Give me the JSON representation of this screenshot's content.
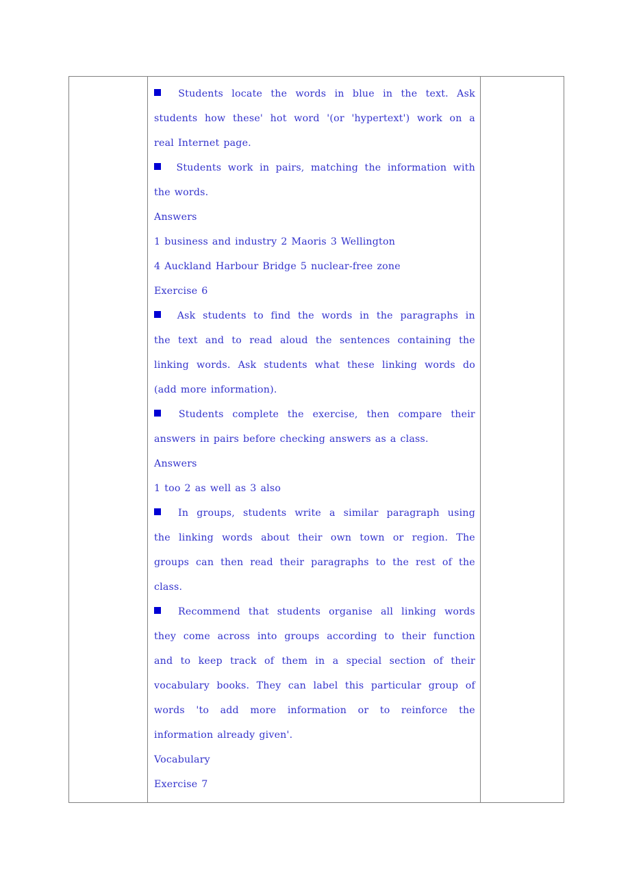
{
  "document": {
    "text_color": "#3333cc",
    "bullet_color": "#0000d4",
    "border_color": "#808080",
    "columns": {
      "left_label": "",
      "right_label": ""
    },
    "bullet_icon": "filled-square-bullet",
    "lines": [
      {
        "id": "l1",
        "bullet": true,
        "justify": true,
        "words": [
          "Students",
          "locate",
          "the",
          "words",
          "in",
          "blue",
          "in",
          "the",
          "text.",
          "Ask"
        ]
      },
      {
        "id": "l2",
        "bullet": false,
        "justify": true,
        "words": [
          "students",
          "how",
          "these'",
          "hot",
          "word",
          "'(or",
          "'hypertext')",
          "work",
          "on",
          "a"
        ]
      },
      {
        "id": "l3",
        "bullet": false,
        "justify": false,
        "words": [
          "real",
          "Internet",
          "page."
        ]
      },
      {
        "id": "l4",
        "bullet": true,
        "justify": true,
        "words": [
          "Students",
          "work",
          "in",
          "pairs,",
          "matching",
          "the",
          "information",
          "with"
        ]
      },
      {
        "id": "l5",
        "bullet": false,
        "justify": false,
        "words": [
          "the",
          "words."
        ]
      },
      {
        "id": "l6",
        "bullet": false,
        "justify": false,
        "words": [
          "Answers"
        ]
      },
      {
        "id": "l7",
        "bullet": false,
        "justify": false,
        "words": [
          "1",
          "business",
          "and",
          "industry",
          "2",
          "Maoris",
          "3",
          "Wellington"
        ]
      },
      {
        "id": "l8",
        "bullet": false,
        "justify": false,
        "words": [
          "4",
          "Auckland",
          "Harbour",
          "Bridge",
          "5",
          "nuclear-free",
          "zone"
        ]
      },
      {
        "id": "l9",
        "bullet": false,
        "justify": false,
        "words": [
          "Exercise",
          "6"
        ]
      },
      {
        "id": "l10",
        "bullet": true,
        "justify": true,
        "words": [
          "Ask",
          "students",
          "to",
          "find",
          "the",
          "words",
          "in",
          "the",
          "paragraphs",
          "in"
        ]
      },
      {
        "id": "l11",
        "bullet": false,
        "justify": true,
        "words": [
          "the",
          "text",
          "and",
          "to",
          "read",
          "aloud",
          "the",
          "sentences",
          "containing",
          "the"
        ]
      },
      {
        "id": "l12",
        "bullet": false,
        "justify": true,
        "words": [
          "linking",
          "words.",
          "Ask",
          "students",
          "what",
          "these",
          "linking",
          "words",
          "do"
        ]
      },
      {
        "id": "l13",
        "bullet": false,
        "justify": false,
        "words": [
          "(add",
          "more",
          "information)."
        ]
      },
      {
        "id": "l14",
        "bullet": true,
        "justify": true,
        "words": [
          "Students",
          "complete",
          "the",
          "exercise,",
          "then",
          "compare",
          "their"
        ]
      },
      {
        "id": "l15",
        "bullet": false,
        "justify": false,
        "words": [
          "answers",
          "in",
          "pairs",
          "before",
          "checking",
          "answers",
          "as",
          "a",
          "class."
        ]
      },
      {
        "id": "l16",
        "bullet": false,
        "justify": false,
        "words": [
          "Answers"
        ]
      },
      {
        "id": "l17",
        "bullet": false,
        "justify": false,
        "words": [
          "1",
          "too",
          "2",
          "as",
          "well",
          "as",
          "3",
          "also"
        ]
      },
      {
        "id": "l18",
        "bullet": true,
        "justify": true,
        "words": [
          "In",
          "groups,",
          "students",
          "write",
          "a",
          "similar",
          "paragraph",
          "using"
        ]
      },
      {
        "id": "l19",
        "bullet": false,
        "justify": true,
        "words": [
          "the",
          "linking",
          "words",
          "about",
          "their",
          "own",
          "town",
          "or",
          "region.",
          "The"
        ]
      },
      {
        "id": "l20",
        "bullet": false,
        "justify": true,
        "words": [
          "groups",
          "can",
          "then",
          "read",
          "their",
          "paragraphs",
          "to",
          "the",
          "rest",
          "of",
          "the"
        ]
      },
      {
        "id": "l21",
        "bullet": false,
        "justify": false,
        "words": [
          "class."
        ]
      },
      {
        "id": "l22",
        "bullet": true,
        "justify": true,
        "words": [
          "Recommend",
          "that",
          "students",
          "organise",
          "all",
          "linking",
          "words"
        ]
      },
      {
        "id": "l23",
        "bullet": false,
        "justify": true,
        "words": [
          "they",
          "come",
          "across",
          "into",
          "groups",
          "according",
          "to",
          "their",
          "function"
        ]
      },
      {
        "id": "l24",
        "bullet": false,
        "justify": true,
        "words": [
          "and",
          "to",
          "keep",
          "track",
          "of",
          "them",
          "in",
          "a",
          "special",
          "section",
          "of",
          "their"
        ]
      },
      {
        "id": "l25",
        "bullet": false,
        "justify": true,
        "words": [
          "vocabulary",
          "books.",
          "They",
          "can",
          "label",
          "this",
          "particular",
          "group",
          "of"
        ]
      },
      {
        "id": "l26",
        "bullet": false,
        "justify": true,
        "words": [
          "words",
          "'to",
          "add",
          "more",
          "information",
          "or",
          "to",
          "reinforce",
          "the"
        ]
      },
      {
        "id": "l27",
        "bullet": false,
        "justify": false,
        "words": [
          "information",
          "already",
          "given'."
        ]
      },
      {
        "id": "l28",
        "bullet": false,
        "justify": false,
        "words": [
          "Vocabulary"
        ]
      },
      {
        "id": "l29",
        "bullet": false,
        "justify": false,
        "words": [
          "Exercise",
          "7"
        ]
      }
    ]
  }
}
